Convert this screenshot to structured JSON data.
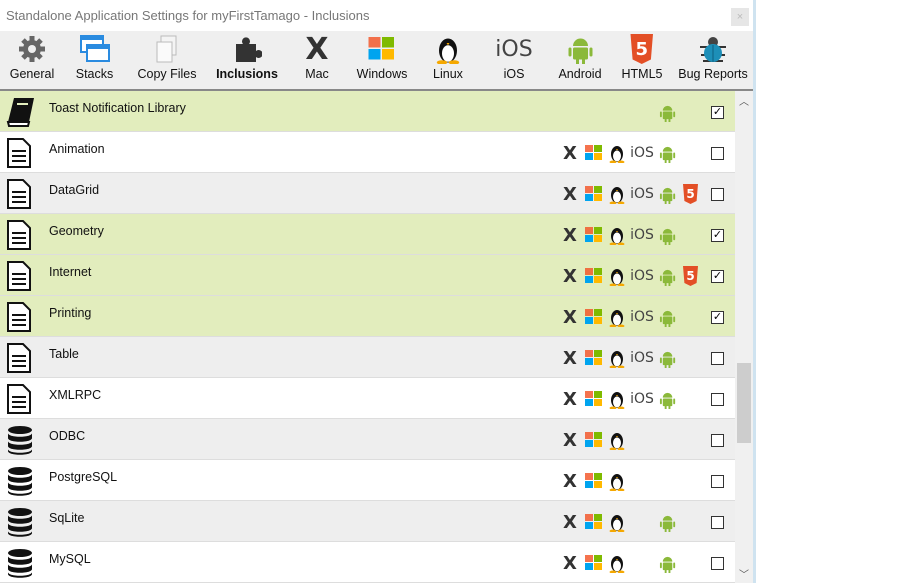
{
  "window": {
    "title": "Standalone Application Settings for myFirstTamago - Inclusions",
    "close": "×"
  },
  "toolbar": [
    {
      "label": "General",
      "icon": "gear-icon"
    },
    {
      "label": "Stacks",
      "icon": "stacks-icon"
    },
    {
      "label": "Copy Files",
      "icon": "copy-files-icon"
    },
    {
      "label": "Inclusions",
      "icon": "puzzle-icon",
      "active": true
    },
    {
      "label": "Mac",
      "icon": "mac-x-icon"
    },
    {
      "label": "Windows",
      "icon": "windows-icon"
    },
    {
      "label": "Linux",
      "icon": "linux-penguin-icon"
    },
    {
      "label": "iOS",
      "icon": "ios-icon"
    },
    {
      "label": "Android",
      "icon": "android-icon"
    },
    {
      "label": "HTML5",
      "icon": "html5-icon"
    },
    {
      "label": "Bug Reports",
      "icon": "bug-icon"
    }
  ],
  "ios_text": "iOS",
  "html5_text": "5",
  "mac_text": "X",
  "check_mark": "✓",
  "rows": [
    {
      "name": "Toast Notification Library",
      "type": "book",
      "platforms": [
        "android"
      ],
      "checked": true
    },
    {
      "name": "Animation",
      "type": "doc",
      "platforms": [
        "mac",
        "win",
        "linux",
        "ios",
        "android"
      ],
      "checked": false
    },
    {
      "name": "DataGrid",
      "type": "doc",
      "platforms": [
        "mac",
        "win",
        "linux",
        "ios",
        "android",
        "html5"
      ],
      "checked": false
    },
    {
      "name": "Geometry",
      "type": "doc",
      "platforms": [
        "mac",
        "win",
        "linux",
        "ios",
        "android"
      ],
      "checked": true
    },
    {
      "name": "Internet",
      "type": "doc",
      "platforms": [
        "mac",
        "win",
        "linux",
        "ios",
        "android",
        "html5"
      ],
      "checked": true
    },
    {
      "name": "Printing",
      "type": "doc",
      "platforms": [
        "mac",
        "win",
        "linux",
        "ios",
        "android"
      ],
      "checked": true
    },
    {
      "name": "Table",
      "type": "doc",
      "platforms": [
        "mac",
        "win",
        "linux",
        "ios",
        "android"
      ],
      "checked": false
    },
    {
      "name": "XMLRPC",
      "type": "doc",
      "platforms": [
        "mac",
        "win",
        "linux",
        "ios",
        "android"
      ],
      "checked": false
    },
    {
      "name": "ODBC",
      "type": "db",
      "platforms": [
        "mac",
        "win",
        "linux"
      ],
      "checked": false
    },
    {
      "name": "PostgreSQL",
      "type": "db",
      "platforms": [
        "mac",
        "win",
        "linux"
      ],
      "checked": false
    },
    {
      "name": "SqLite",
      "type": "db",
      "platforms": [
        "mac",
        "win",
        "linux",
        "android"
      ],
      "checked": false
    },
    {
      "name": "MySQL",
      "type": "db",
      "platforms": [
        "mac",
        "win",
        "linux",
        "android"
      ],
      "checked": false
    }
  ],
  "colors": {
    "checked_row": "#e2edbd",
    "row_alt": "#eeeeee",
    "row": "#ffffff",
    "android": "#8bb93a",
    "html5": "#e34f26"
  }
}
